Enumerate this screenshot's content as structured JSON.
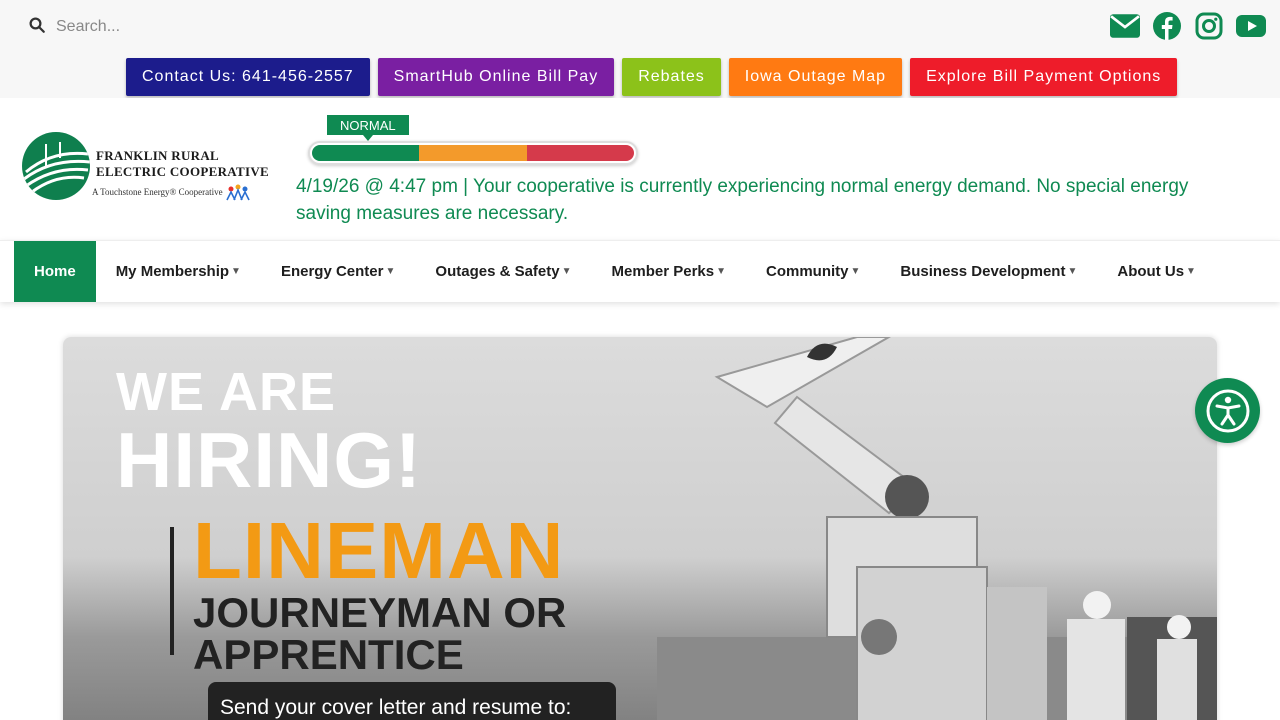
{
  "search": {
    "placeholder": "Search..."
  },
  "social": {
    "icons": [
      "envelope-icon",
      "facebook-icon",
      "instagram-icon",
      "youtube-icon"
    ],
    "color": "#0f8a52"
  },
  "quicklinks": [
    {
      "label": "Contact Us: 641-456-2557",
      "color": "#1c1c8c"
    },
    {
      "label": "SmartHub Online Bill Pay",
      "color": "#7a1fa2"
    },
    {
      "label": "Rebates",
      "color": "#8cc21a"
    },
    {
      "label": "Iowa Outage Map",
      "color": "#ff7a12"
    },
    {
      "label": "Explore Bill Payment Options",
      "color": "#ee1c2a"
    }
  ],
  "logo": {
    "line1": "FRANKLIN RURAL",
    "line2": "ELECTRIC COOPERATIVE",
    "tagline": "A Touchstone Energy® Cooperative"
  },
  "energy_status": {
    "badge": "NORMAL",
    "message": "4/19/26 @ 4:47 pm | Your cooperative is currently experiencing normal energy demand. No special energy saving measures are necessary."
  },
  "nav": {
    "items": [
      {
        "label": "Home",
        "active": true
      },
      {
        "label": "My Membership",
        "dropdown": true
      },
      {
        "label": "Energy Center",
        "dropdown": true
      },
      {
        "label": "Outages & Safety",
        "dropdown": true
      },
      {
        "label": "Member Perks",
        "dropdown": true
      },
      {
        "label": "Community",
        "dropdown": true
      },
      {
        "label": "Business Development",
        "dropdown": true
      },
      {
        "label": "About Us",
        "dropdown": true
      }
    ],
    "active_color": "#0f8a52"
  },
  "hero": {
    "line1": "WE ARE",
    "line2": "HIRING!",
    "line3": "LINEMAN",
    "line4a": "JOURNEYMAN OR",
    "line4b": "APPRENTICE",
    "cta": "Send your cover letter and resume to:"
  },
  "accessibility": {
    "icon": "accessibility-icon"
  }
}
